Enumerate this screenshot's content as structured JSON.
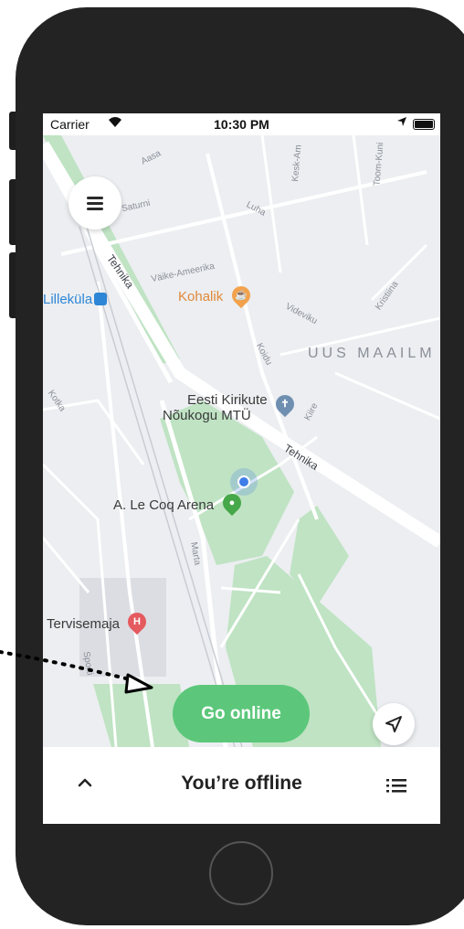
{
  "status_bar": {
    "carrier": "Carrier",
    "time": "10:30 PM"
  },
  "map": {
    "streets": {
      "aasa": "Aasa",
      "saturni": "Saturni",
      "luha": "Luha",
      "kesk_ameerika": "Kesk-Am",
      "toom_kuninga": "Toom-Kuni",
      "tehnika_1": "Tehnika",
      "vaike_ameerika": "Väike-Ameerika",
      "kristiina": "Kristiina",
      "videviku": "Videviku",
      "koidu": "Koidu",
      "kotka": "Kotka",
      "kiire": "Kiire",
      "tehnika_2": "Tehnika",
      "marta": "Marta",
      "sporti": "Sporti"
    },
    "pois": {
      "lillekula": "Lilleküla",
      "kohalik": "Kohalik",
      "district": "UUS MAAILM",
      "church_line1": "Eesti Kirikute",
      "church_line2": "Nõukogu MTÜ",
      "arena": "A. Le Coq Arena",
      "tervisemaja": "Tervisemaja"
    }
  },
  "actions": {
    "go_online": "Go online"
  },
  "bottom_bar": {
    "title": "You’re offline"
  },
  "colors": {
    "go_online": "#5cc77a",
    "park": "#bfe3c3",
    "road": "#ffffff",
    "frame": "#232323"
  }
}
